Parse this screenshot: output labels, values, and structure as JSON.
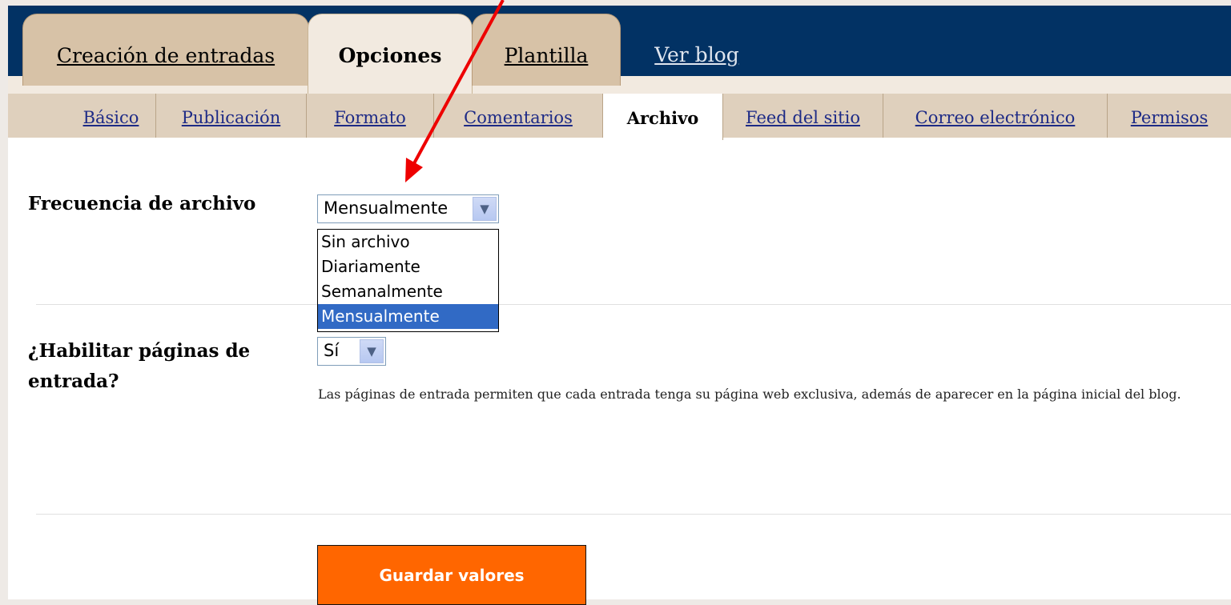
{
  "tabs": [
    {
      "label": "Creación de entradas"
    },
    {
      "label": "Opciones"
    },
    {
      "label": "Plantilla"
    },
    {
      "label": "Ver blog"
    }
  ],
  "subtabs": [
    {
      "label": "Básico"
    },
    {
      "label": "Publicación"
    },
    {
      "label": "Formato"
    },
    {
      "label": "Comentarios"
    },
    {
      "label": "Archivo"
    },
    {
      "label": "Feed del sitio"
    },
    {
      "label": "Correo electrónico"
    },
    {
      "label": "Permisos"
    }
  ],
  "archive": {
    "label": "Frecuencia de archivo",
    "selected": "Mensualmente",
    "options": [
      "Sin archivo",
      "Diariamente",
      "Semanalmente",
      "Mensualmente"
    ]
  },
  "post_pages": {
    "label_line1": "¿Habilitar páginas de",
    "label_line2": "entrada?",
    "selected": "Sí",
    "help": "Las páginas de entrada permiten que cada entrada tenga su página web exclusiva, además de aparecer en la página inicial del blog."
  },
  "save_button": "Guardar valores",
  "colors": {
    "accent": "#ff6600",
    "header": "#023264",
    "annotation": "#ee0000"
  }
}
